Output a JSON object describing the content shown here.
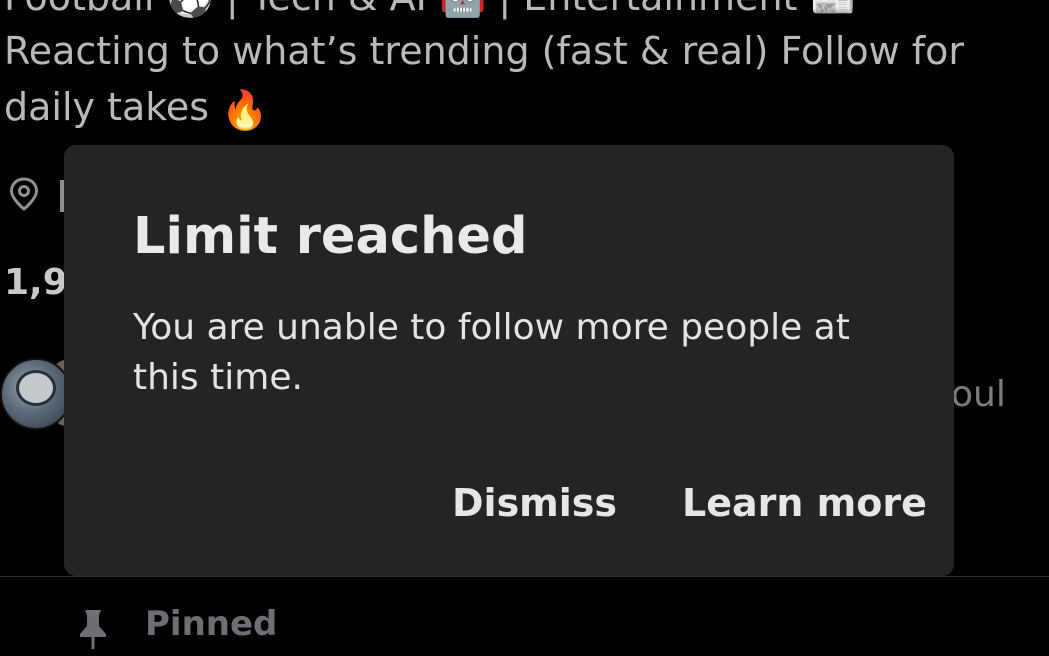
{
  "profile": {
    "bio_line1": "Football ⚽ | Tech & AI 🤖 | Entertainment 📰",
    "bio_line2": "Reacting to what’s trending (fast & real) Follow for",
    "bio_line3_text": "daily takes",
    "bio_line3_emoji": "🔥",
    "location_icon": "location-pin-icon",
    "follow_count_partial": "1,9",
    "right_partial_text": "oul"
  },
  "dialog": {
    "title": "Limit reached",
    "message": "You are unable to follow more people at this time.",
    "dismiss_label": "Dismiss",
    "learn_more_label": "Learn more",
    "background_color": "#242424"
  },
  "pinned": {
    "icon": "pin-icon",
    "label": "Pinned"
  }
}
